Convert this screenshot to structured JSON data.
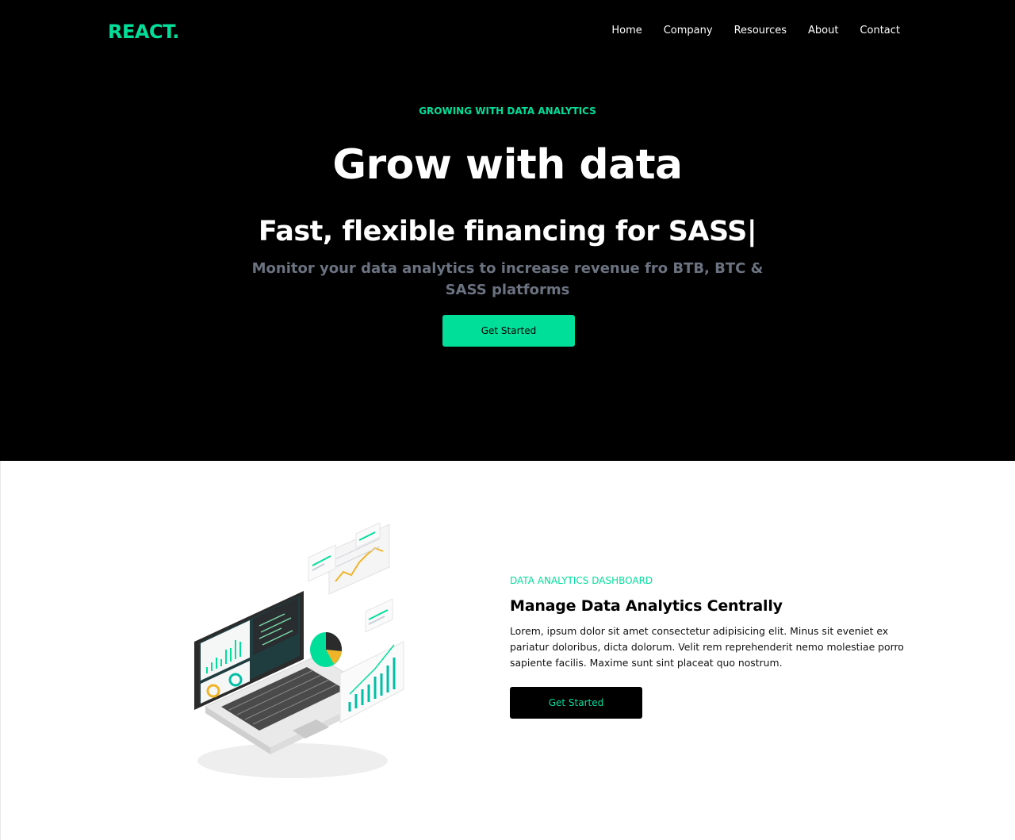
{
  "colors": {
    "accent": "#00df9a",
    "hero_bg": "#000000",
    "muted_text": "#6b7280"
  },
  "nav": {
    "logo": "REACT.",
    "items": [
      "Home",
      "Company",
      "Resources",
      "About",
      "Contact"
    ]
  },
  "hero": {
    "eyebrow": "GROWING WITH DATA ANALYTICS",
    "title": "Grow with data",
    "typed_line": "Fast, flexible financing for SASS|",
    "subtitle": "Monitor your data analytics to increase revenue fro BTB, BTC & SASS platforms",
    "cta_label": "Get Started"
  },
  "analytics": {
    "illustration_icon": "laptop-analytics-illustration",
    "eyebrow": "DATA ANALYTICS DASHBOARD",
    "title": "Manage Data Analytics Centrally",
    "body": "Lorem, ipsum dolor sit amet consectetur adipisicing elit. Minus sit eveniet ex pariatur doloribus, dicta dolorum. Velit rem reprehenderit nemo molestiae porro sapiente facilis. Maxime sunt sint placeat quo nostrum.",
    "cta_label": "Get Started"
  }
}
